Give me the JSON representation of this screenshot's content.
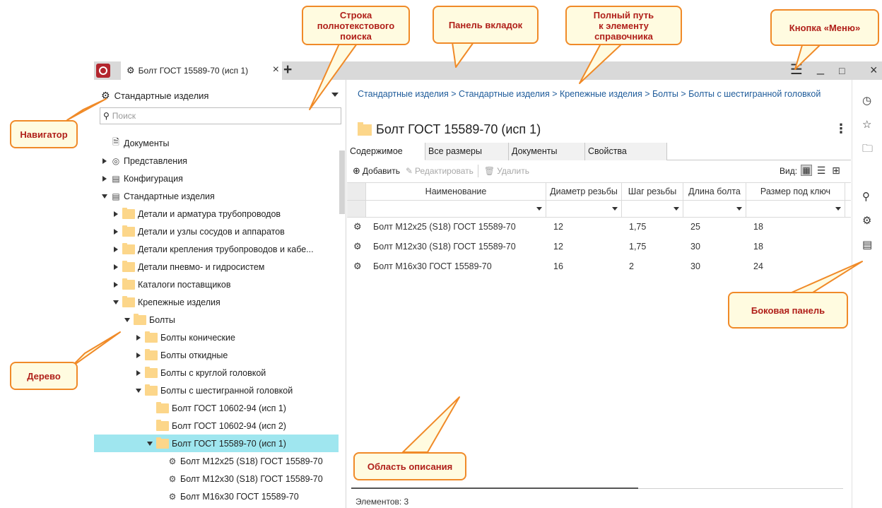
{
  "callouts": {
    "search": [
      "Строка",
      "полнотекстового",
      "поиска"
    ],
    "tabs_panel": "Панель вкладок",
    "full_path": [
      "Полный путь",
      "к элементу",
      "справочника"
    ],
    "menu_button": "Кнопка «Меню»",
    "navigator": "Навигатор",
    "tree": "Дерево",
    "side_panel": "Боковая панель",
    "description": "Область описания"
  },
  "tabbar": {
    "tab_label": "Болт ГОСТ 15589-70 (исп 1)",
    "close": "×",
    "add": "+",
    "menu": "☰",
    "minimize": "_",
    "maximize": "□",
    "close_window": "×"
  },
  "navigator": {
    "label": "Стандартные изделия",
    "search_placeholder": "Поиск"
  },
  "tree": [
    {
      "label": "Документы",
      "twist": "none",
      "icon": "doc",
      "level": 0
    },
    {
      "label": "Представления",
      "twist": "right",
      "icon": "view",
      "level": 0
    },
    {
      "label": "Конфигурация",
      "twist": "right",
      "icon": "book",
      "level": 0
    },
    {
      "label": "Стандартные изделия",
      "twist": "down",
      "icon": "book",
      "level": 0
    },
    {
      "label": "Детали и арматура трубопроводов",
      "twist": "right",
      "icon": "folder",
      "level": 1
    },
    {
      "label": "Детали и узлы сосудов и аппаратов",
      "twist": "right",
      "icon": "folder",
      "level": 1
    },
    {
      "label": "Детали крепления трубопроводов и кабе...",
      "twist": "right",
      "icon": "folder",
      "level": 1
    },
    {
      "label": "Детали пневмо- и гидросистем",
      "twist": "right",
      "icon": "folder",
      "level": 1
    },
    {
      "label": "Каталоги поставщиков",
      "twist": "right",
      "icon": "folder",
      "level": 1
    },
    {
      "label": "Крепежные изделия",
      "twist": "down",
      "icon": "folder",
      "level": 1
    },
    {
      "label": "Болты",
      "twist": "down",
      "icon": "folder",
      "level": 2
    },
    {
      "label": "Болты конические",
      "twist": "right",
      "icon": "folder",
      "level": 3
    },
    {
      "label": "Болты откидные",
      "twist": "right",
      "icon": "folder",
      "level": 3
    },
    {
      "label": "Болты с круглой головкой",
      "twist": "right",
      "icon": "folder",
      "level": 3
    },
    {
      "label": "Болты с шестигранной головкой",
      "twist": "down",
      "icon": "folder",
      "level": 3
    },
    {
      "label": "Болт ГОСТ 10602-94 (исп 1)",
      "twist": "none",
      "icon": "folder",
      "level": 4
    },
    {
      "label": "Болт ГОСТ 10602-94 (исп 2)",
      "twist": "none",
      "icon": "folder",
      "level": 4
    },
    {
      "label": "Болт ГОСТ 15589-70 (исп 1)",
      "twist": "down",
      "icon": "folder",
      "level": 4,
      "selected": true
    },
    {
      "label": "Болт М12х25 (S18) ГОСТ 15589-70",
      "twist": "none",
      "icon": "part",
      "level": 5
    },
    {
      "label": "Болт М12х30 (S18) ГОСТ 15589-70",
      "twist": "none",
      "icon": "part",
      "level": 5
    },
    {
      "label": "Болт М16х30 ГОСТ 15589-70",
      "twist": "none",
      "icon": "part",
      "level": 5
    }
  ],
  "main": {
    "breadcrumb": "Стандартные изделия > Стандартные изделия > Крепежные изделия > Болты > Болты с шестигранной головкой",
    "title": "Болт ГОСТ 15589-70 (исп 1)",
    "kebab": "⋮",
    "tabs": [
      "Содержимое",
      "Все размеры",
      "Документы",
      "Свойства"
    ],
    "toolbar": {
      "add": "Добавить",
      "edit": "Редактировать",
      "delete": "Удалить",
      "view_label": "Вид:"
    },
    "columns": [
      "Наименование",
      "Диаметр резьбы",
      "Шаг резьбы",
      "Длина болта",
      "Размер под ключ"
    ],
    "rows": [
      [
        "Болт М12х25 (S18) ГОСТ 15589-70",
        "12",
        "1,75",
        "25",
        "18"
      ],
      [
        "Болт М12х30 (S18) ГОСТ 15589-70",
        "12",
        "1,75",
        "30",
        "18"
      ],
      [
        "Болт М16х30 ГОСТ 15589-70",
        "16",
        "2",
        "30",
        "24"
      ]
    ],
    "status": "Элементов: 3"
  },
  "side_panel": [
    "clock-icon",
    "star-icon",
    "folder-open-icon",
    "search-icon",
    "search-part-icon",
    "book-icon"
  ],
  "colors": {
    "selection": "#9fe6ef",
    "callout_border": "#f08a28",
    "callout_text": "#b0201a",
    "link": "#1e5b9a",
    "folder": "#fcd68a"
  }
}
